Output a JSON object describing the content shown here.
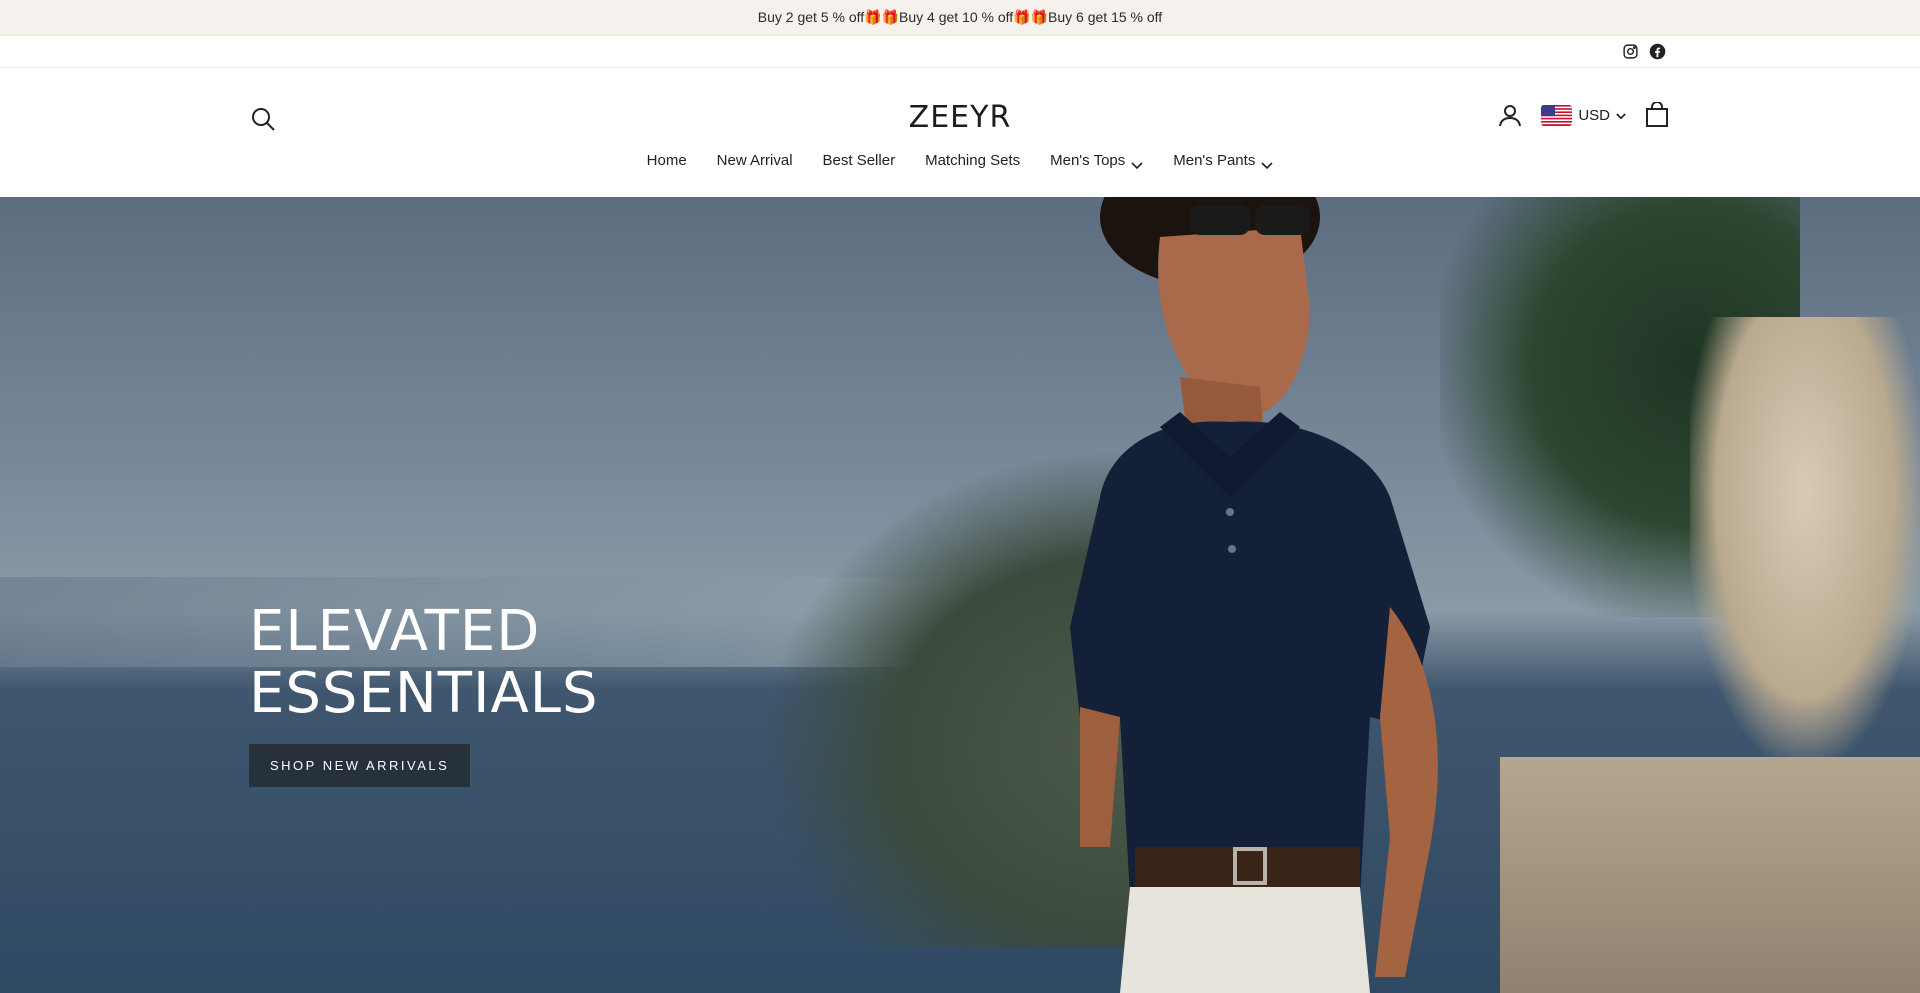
{
  "announcement": "Buy 2 get 5 % off🎁🎁Buy 4 get 10 % off🎁🎁Buy 6 get 15 % off",
  "social": {
    "icons": [
      "instagram-icon",
      "facebook-icon"
    ]
  },
  "header": {
    "logo": "ZEEYR",
    "currency": "USD",
    "icons": [
      "search-icon",
      "account-icon",
      "us-flag-icon",
      "chevron-down-icon",
      "cart-icon"
    ]
  },
  "nav": {
    "items": [
      {
        "label": "Home"
      },
      {
        "label": "New Arrival"
      },
      {
        "label": "Best Seller"
      },
      {
        "label": "Matching Sets"
      },
      {
        "label": "Men's Tops"
      },
      {
        "label": "Men's Pants"
      }
    ]
  },
  "hero": {
    "title_line1": "ELEVATED",
    "title_line2": "ESSENTIALS",
    "button": "SHOP NEW ARRIVALS"
  },
  "colors": {
    "announce_bg": "#f5f1ec",
    "button_bg": "#26313b",
    "text": "#222222"
  }
}
